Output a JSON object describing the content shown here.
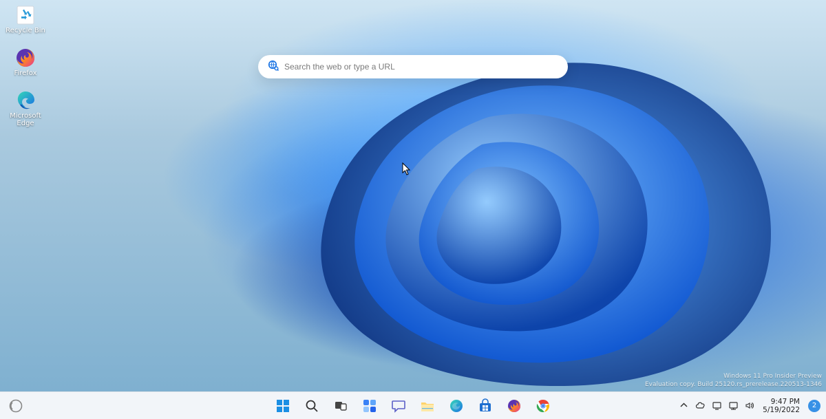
{
  "desktop_icons": {
    "recycle_bin": "Recycle Bin",
    "firefox": "Firefox",
    "edge": "Microsoft Edge"
  },
  "search": {
    "placeholder": "Search the web or type a URL"
  },
  "watermark": {
    "line1": "Windows 11 Pro Insider Preview",
    "line2": "Evaluation copy. Build 25120.rs_prerelease.220513-1346"
  },
  "taskbar": {
    "items": [
      {
        "name": "start"
      },
      {
        "name": "search"
      },
      {
        "name": "task-view"
      },
      {
        "name": "widgets"
      },
      {
        "name": "chat"
      },
      {
        "name": "file-explorer"
      },
      {
        "name": "edge"
      },
      {
        "name": "store"
      },
      {
        "name": "firefox"
      },
      {
        "name": "chrome"
      }
    ]
  },
  "tray": {
    "notification_count": "2",
    "time": "9:47 PM",
    "date": "5/19/2022"
  }
}
